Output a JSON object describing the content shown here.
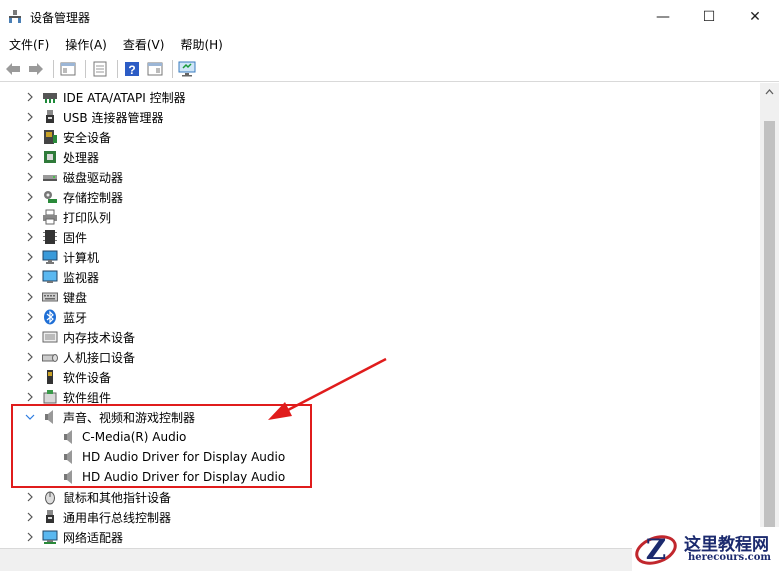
{
  "window": {
    "title": "设备管理器",
    "minimize_glyph": "—",
    "maximize_glyph": "☐",
    "close_glyph": "✕"
  },
  "menu": {
    "items": [
      {
        "label": "文件(F)"
      },
      {
        "label": "操作(A)"
      },
      {
        "label": "查看(V)"
      },
      {
        "label": "帮助(H)"
      }
    ]
  },
  "toolbar": {
    "buttons": [
      "back-arrow-icon",
      "forward-arrow-icon",
      "properties-panel-icon",
      "driver-details-icon",
      "help-icon",
      "action-panel-icon",
      "monitor-scan-icon"
    ]
  },
  "tree": {
    "categories": [
      {
        "label": "IDE ATA/ATAPI 控制器",
        "icon": "ide-controller-icon",
        "expanded": false
      },
      {
        "label": "USB 连接器管理器",
        "icon": "usb-icon",
        "expanded": false
      },
      {
        "label": "安全设备",
        "icon": "security-device-icon",
        "expanded": false
      },
      {
        "label": "处理器",
        "icon": "processor-icon",
        "expanded": false
      },
      {
        "label": "磁盘驱动器",
        "icon": "disk-drive-icon",
        "expanded": false
      },
      {
        "label": "存储控制器",
        "icon": "storage-controller-icon",
        "expanded": false
      },
      {
        "label": "打印队列",
        "icon": "printer-icon",
        "expanded": false
      },
      {
        "label": "固件",
        "icon": "firmware-icon",
        "expanded": false
      },
      {
        "label": "计算机",
        "icon": "computer-icon",
        "expanded": false
      },
      {
        "label": "监视器",
        "icon": "monitor-icon",
        "expanded": false
      },
      {
        "label": "键盘",
        "icon": "keyboard-icon",
        "expanded": false
      },
      {
        "label": "蓝牙",
        "icon": "bluetooth-icon",
        "expanded": false
      },
      {
        "label": "内存技术设备",
        "icon": "memory-device-icon",
        "expanded": false
      },
      {
        "label": "人机接口设备",
        "icon": "hid-icon",
        "expanded": false
      },
      {
        "label": "软件设备",
        "icon": "software-device-icon",
        "expanded": false
      },
      {
        "label": "软件组件",
        "icon": "software-component-icon",
        "expanded": false
      },
      {
        "label": "声音、视频和游戏控制器",
        "icon": "speaker-icon",
        "expanded": true,
        "children": [
          {
            "label": "C-Media(R) Audio",
            "icon": "speaker-icon"
          },
          {
            "label": "HD Audio Driver for Display Audio",
            "icon": "speaker-icon"
          },
          {
            "label": "HD Audio Driver for Display Audio",
            "icon": "speaker-icon"
          }
        ]
      },
      {
        "label": "鼠标和其他指针设备",
        "icon": "mouse-icon",
        "expanded": false
      },
      {
        "label": "通用串行总线控制器",
        "icon": "usb-controller-icon",
        "expanded": false
      },
      {
        "label": "网络适配器",
        "icon": "network-adapter-icon",
        "expanded": false
      }
    ]
  },
  "annotation": {
    "color": "#e01c1c"
  },
  "watermark": {
    "title": "这里教程网",
    "subtitle": "herecours.com"
  }
}
